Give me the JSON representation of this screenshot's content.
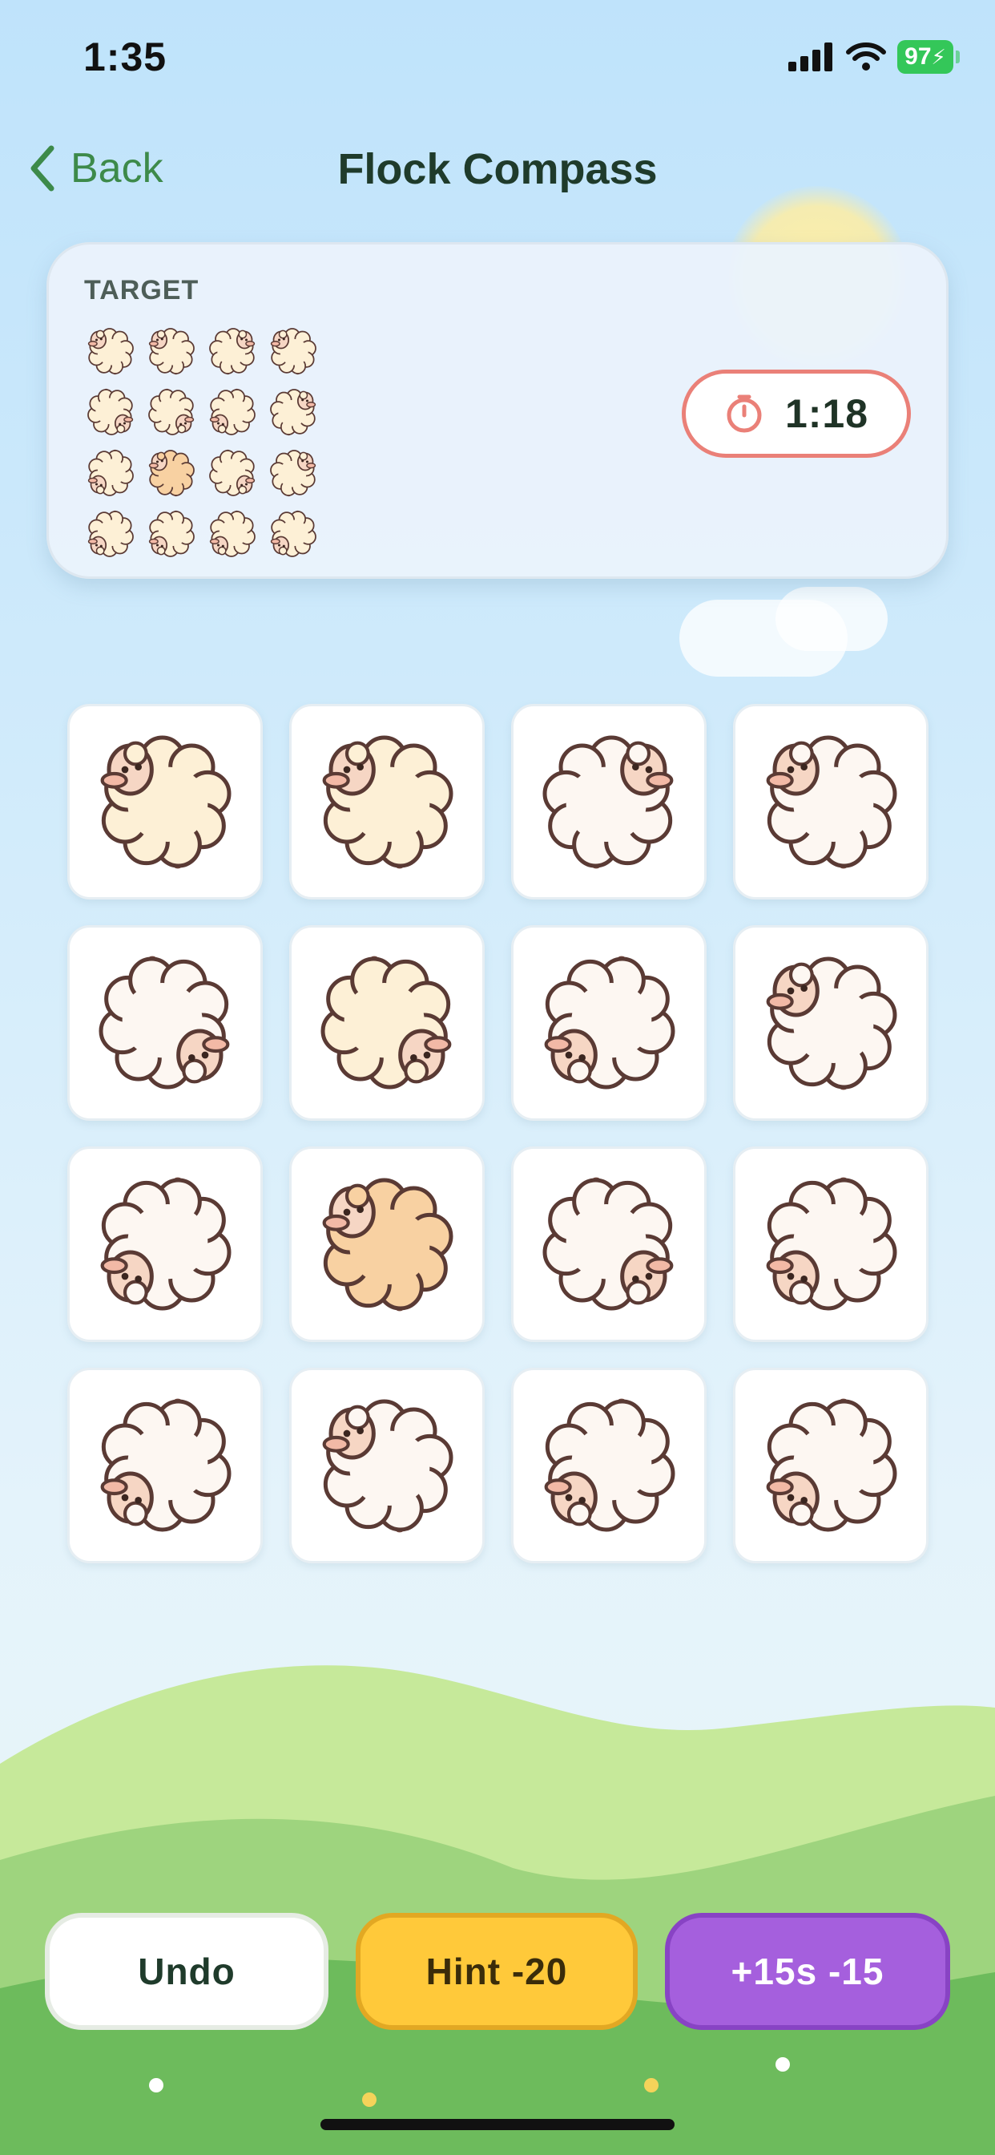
{
  "status_bar": {
    "time": "1:35",
    "battery": "97"
  },
  "nav": {
    "back_label": "Back",
    "title": "Flock Compass"
  },
  "target": {
    "label": "TARGET",
    "timer": "1:18",
    "cells": [
      {
        "dir": "nw",
        "wool": "cream"
      },
      {
        "dir": "nw",
        "wool": "cream"
      },
      {
        "dir": "ne",
        "wool": "cream"
      },
      {
        "dir": "nw",
        "wool": "cream"
      },
      {
        "dir": "se",
        "wool": "cream"
      },
      {
        "dir": "se",
        "wool": "cream"
      },
      {
        "dir": "sw",
        "wool": "cream"
      },
      {
        "dir": "ne",
        "wool": "cream"
      },
      {
        "dir": "sw",
        "wool": "cream"
      },
      {
        "dir": "nw",
        "wool": "peach"
      },
      {
        "dir": "se",
        "wool": "cream"
      },
      {
        "dir": "ne",
        "wool": "cream"
      },
      {
        "dir": "sw",
        "wool": "cream"
      },
      {
        "dir": "sw",
        "wool": "cream"
      },
      {
        "dir": "sw",
        "wool": "cream"
      },
      {
        "dir": "sw",
        "wool": "cream"
      }
    ]
  },
  "board": {
    "tiles": [
      {
        "dir": "nw",
        "wool": "cream"
      },
      {
        "dir": "nw",
        "wool": "cream"
      },
      {
        "dir": "ne",
        "wool": "white"
      },
      {
        "dir": "nw",
        "wool": "white"
      },
      {
        "dir": "se",
        "wool": "white"
      },
      {
        "dir": "se",
        "wool": "cream"
      },
      {
        "dir": "sw",
        "wool": "white"
      },
      {
        "dir": "nw",
        "wool": "white"
      },
      {
        "dir": "sw",
        "wool": "white"
      },
      {
        "dir": "nw",
        "wool": "peach"
      },
      {
        "dir": "se",
        "wool": "white"
      },
      {
        "dir": "sw",
        "wool": "white"
      },
      {
        "dir": "sw",
        "wool": "white"
      },
      {
        "dir": "nw",
        "wool": "white"
      },
      {
        "dir": "sw",
        "wool": "white"
      },
      {
        "dir": "sw",
        "wool": "white"
      }
    ]
  },
  "controls": {
    "undo_label": "Undo",
    "hint_label": "Hint  -20",
    "time_label": "+15s  -15"
  },
  "colors": {
    "accent_green": "#3d8a4a",
    "timer_border": "#ea8078",
    "hint_yellow": "#ffc93a",
    "time_purple": "#a55fdd",
    "wool_cream": "#fdf0d6",
    "wool_white": "#fdf7f2",
    "wool_peach": "#f8d1a2"
  }
}
